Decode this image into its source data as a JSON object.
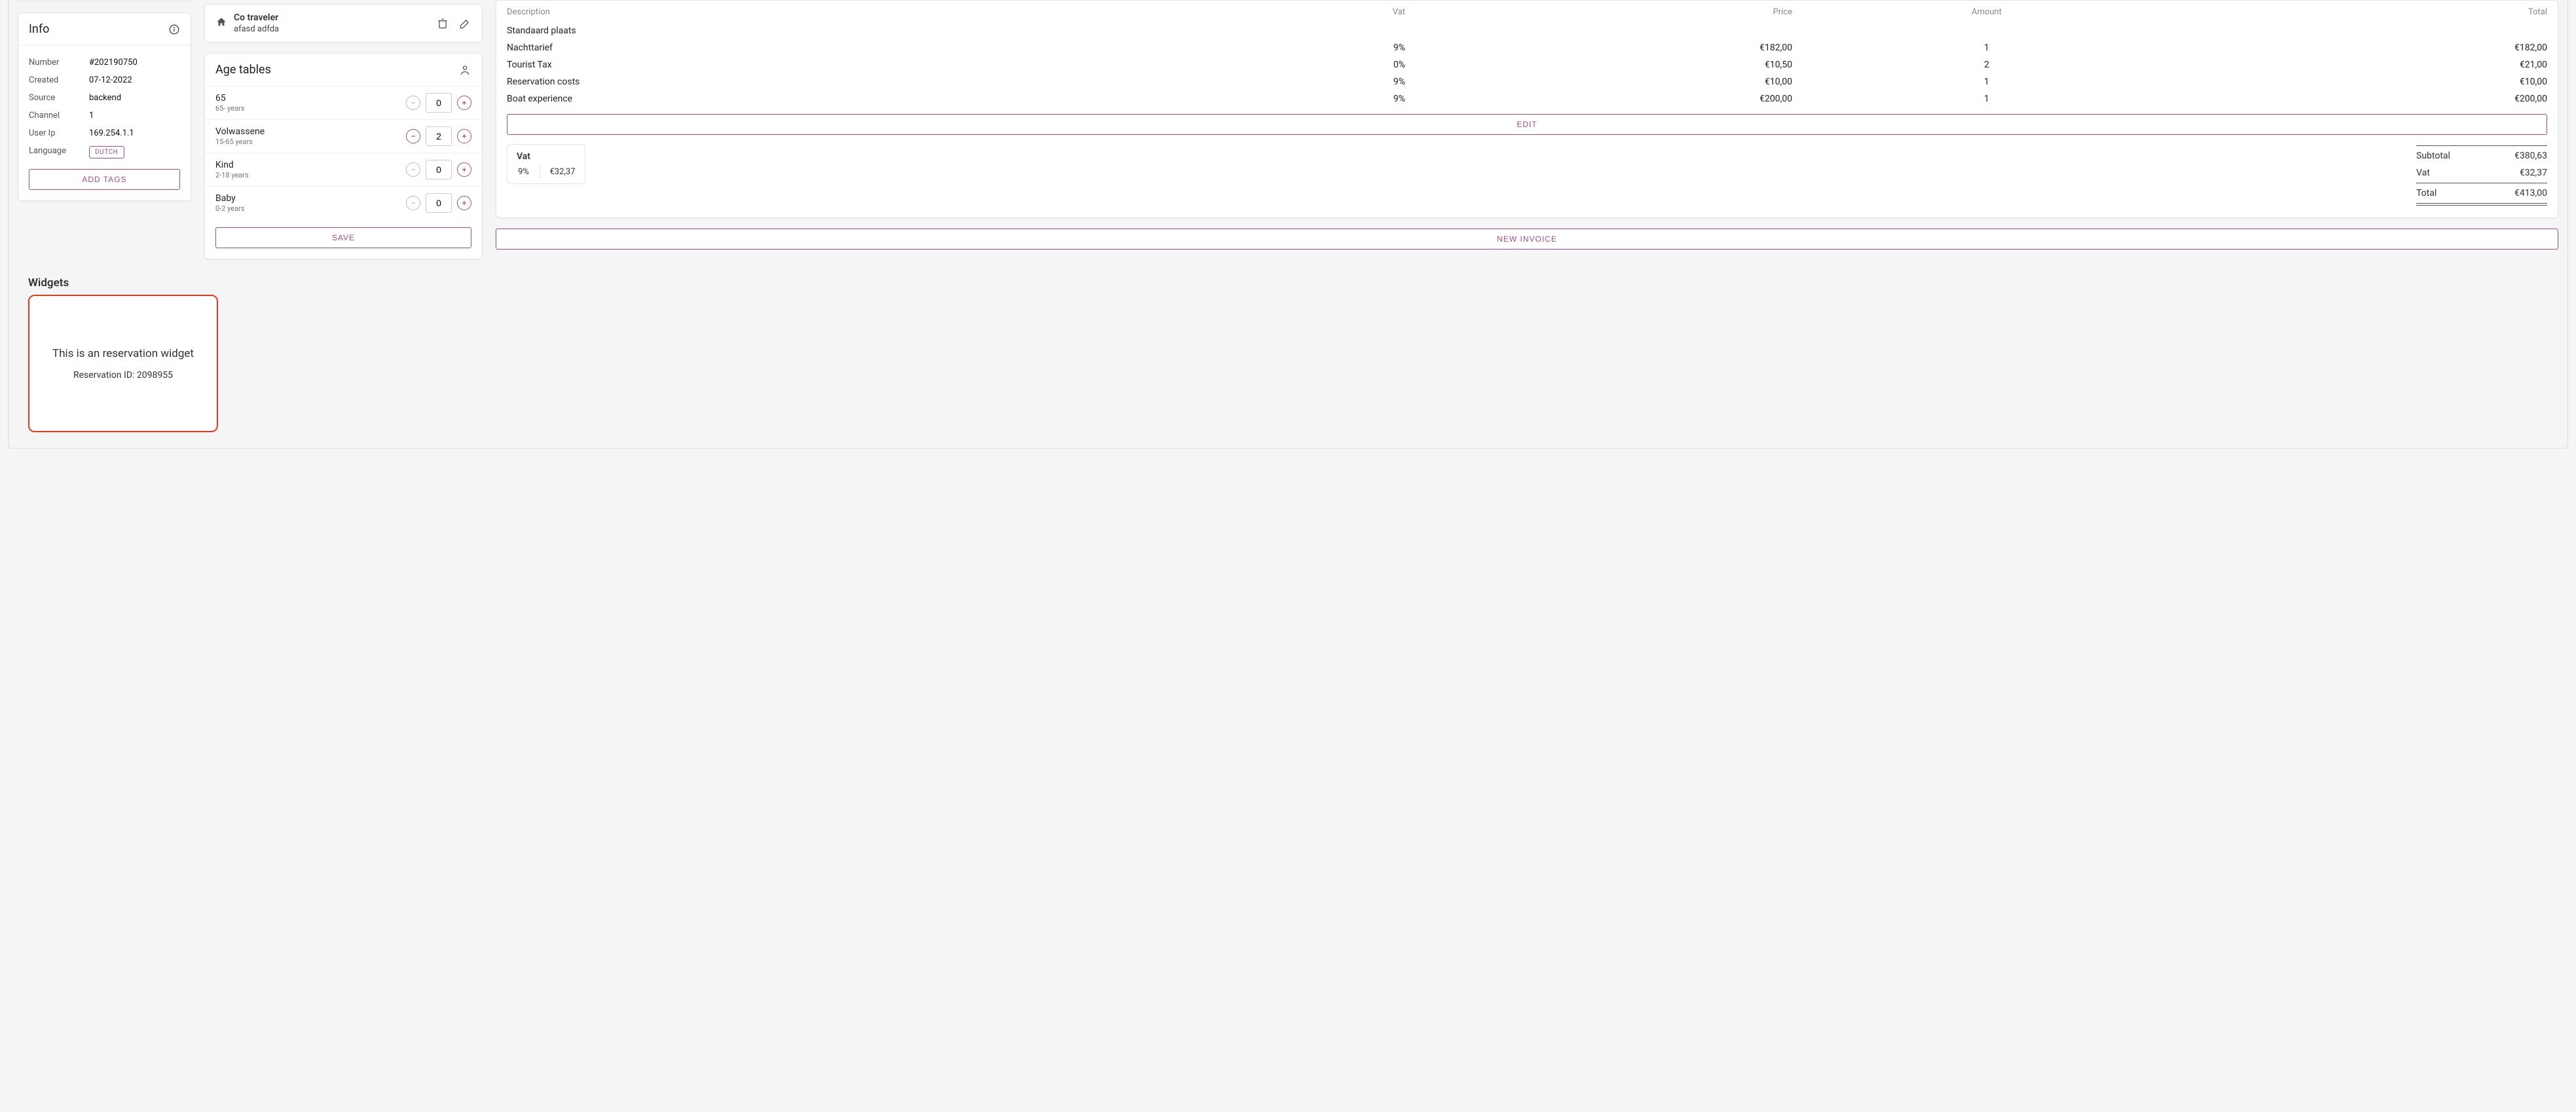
{
  "info": {
    "title": "Info",
    "rows": {
      "number_label": "Number",
      "number_value": "#202190750",
      "created_label": "Created",
      "created_value": "07-12-2022",
      "source_label": "Source",
      "source_value": "backend",
      "channel_label": "Channel",
      "channel_value": "1",
      "userip_label": "User Ip",
      "userip_value": "169.254.1.1",
      "language_label": "Language",
      "language_chip": "DUTCH"
    },
    "add_tags": "ADD TAGS"
  },
  "cotraveler": {
    "title": "Co traveler",
    "subtitle": "afasd adfda"
  },
  "age_tables": {
    "title": "Age tables",
    "rows": [
      {
        "name": "65",
        "sub": "65- years",
        "value": "0",
        "minus_enabled": false
      },
      {
        "name": "Volwassene",
        "sub": "15-65 years",
        "value": "2",
        "minus_enabled": true
      },
      {
        "name": "Kind",
        "sub": "2-18 years",
        "value": "0",
        "minus_enabled": false
      },
      {
        "name": "Baby",
        "sub": "0-2 years",
        "value": "0",
        "minus_enabled": false
      }
    ],
    "save": "SAVE"
  },
  "invoice": {
    "headers": {
      "description": "Description",
      "vat": "Vat",
      "price": "Price",
      "amount": "Amount",
      "total": "Total"
    },
    "group_label": "Standaard plaats",
    "lines": [
      {
        "desc": "Nachttarief",
        "vat": "9%",
        "price": "€182,00",
        "amount": "1",
        "total": "€182,00"
      },
      {
        "desc": "Tourist Tax",
        "vat": "0%",
        "price": "€10,50",
        "amount": "2",
        "total": "€21,00"
      },
      {
        "desc": "Reservation costs",
        "vat": "9%",
        "price": "€10,00",
        "amount": "1",
        "total": "€10,00"
      },
      {
        "desc": "Boat experience",
        "vat": "9%",
        "price": "€200,00",
        "amount": "1",
        "total": "€200,00"
      }
    ],
    "edit": "EDIT",
    "vat_box": {
      "title": "Vat",
      "rate": "9%",
      "amount": "€32,37"
    },
    "totals": {
      "subtotal_label": "Subtotal",
      "subtotal_value": "€380,63",
      "vat_label": "Vat",
      "vat_value": "€32,37",
      "total_label": "Total",
      "total_value": "€413,00"
    },
    "new_invoice": "NEW INVOICE"
  },
  "widgets": {
    "title": "Widgets",
    "card_line1": "This is an reservation widget",
    "card_line2": "Reservation ID: 2098955"
  }
}
